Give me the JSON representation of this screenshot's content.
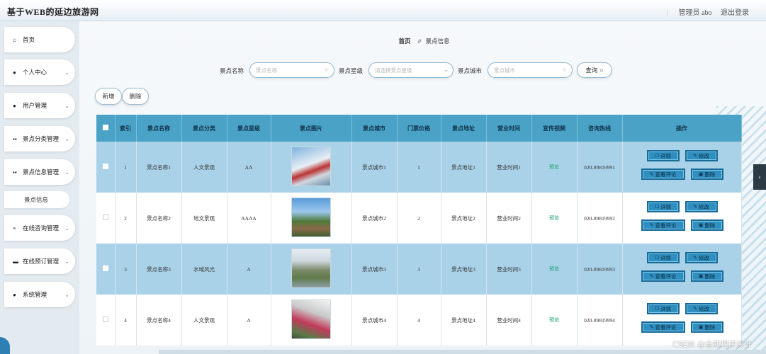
{
  "header": {
    "app_title": "基于WEB的延边旅游网",
    "admin_label": "管理员 abo",
    "logout_label": "退出登录"
  },
  "sidebar": {
    "items": [
      {
        "label": "首页",
        "icon": "home-icon",
        "chevron": false
      },
      {
        "label": "个人中心",
        "icon": "user-icon",
        "chevron": true
      },
      {
        "label": "用户管理",
        "icon": "user-icon",
        "chevron": true
      },
      {
        "label": "景点分类管理",
        "icon": "grid-icon",
        "chevron": true
      },
      {
        "label": "景点信息管理",
        "icon": "grid-icon",
        "chevron": true
      },
      {
        "label": "在线咨询管理",
        "icon": "list-icon",
        "chevron": true
      },
      {
        "label": "在线预订管理",
        "icon": "chat-icon",
        "chevron": true
      },
      {
        "label": "系统管理",
        "icon": "location-icon",
        "chevron": true
      }
    ],
    "active_sub": "景点信息"
  },
  "breadcrumb": {
    "home": "首页",
    "sep": "//",
    "current": "景点信息"
  },
  "search": {
    "name_label": "景点名称",
    "name_placeholder": "景点名称",
    "star_label": "景点星级",
    "star_placeholder": "请选择景点星级",
    "city_label": "景点城市",
    "city_placeholder": "景点城市",
    "button_label": "查询"
  },
  "actions": {
    "add": "新增",
    "delete": "删除"
  },
  "table": {
    "columns": [
      "索引",
      "景点名称",
      "景点分类",
      "景点星级",
      "景点图片",
      "景点城市",
      "门票价格",
      "景点地址",
      "营业时间",
      "宣传视频",
      "咨询热线",
      "操作"
    ],
    "rows": [
      {
        "index": "1",
        "name": "景点名称1",
        "category": "人文景观",
        "star": "AA",
        "city": "景点城市1",
        "price": "1",
        "address": "景点地址1",
        "hours": "营业时间1",
        "video": "预览",
        "hotline": "020-89819991"
      },
      {
        "index": "2",
        "name": "景点名称2",
        "category": "地文景观",
        "star": "AAAA",
        "city": "景点城市2",
        "price": "2",
        "address": "景点地址2",
        "hours": "营业时间2",
        "video": "预览",
        "hotline": "020-89819992"
      },
      {
        "index": "3",
        "name": "景点名称3",
        "category": "水域风光",
        "star": "A",
        "city": "景点城市3",
        "price": "3",
        "address": "景点地址3",
        "hours": "营业时间3",
        "video": "预览",
        "hotline": "020-89819993"
      },
      {
        "index": "4",
        "name": "景点名称4",
        "category": "人文景观",
        "star": "A",
        "city": "景点城市4",
        "price": "4",
        "address": "景点地址4",
        "hours": "营业时间4",
        "video": "预览",
        "hotline": "020-89819994"
      }
    ],
    "ops": {
      "detail": "详情",
      "edit": "修改",
      "comments": "查看评论",
      "delete": "删除"
    }
  },
  "watermark": "CSDN @全新程序设计",
  "colors": {
    "header_row": "#4aa3c6",
    "odd_row": "#a9d2e8",
    "op_button": "#2f8fc0"
  }
}
